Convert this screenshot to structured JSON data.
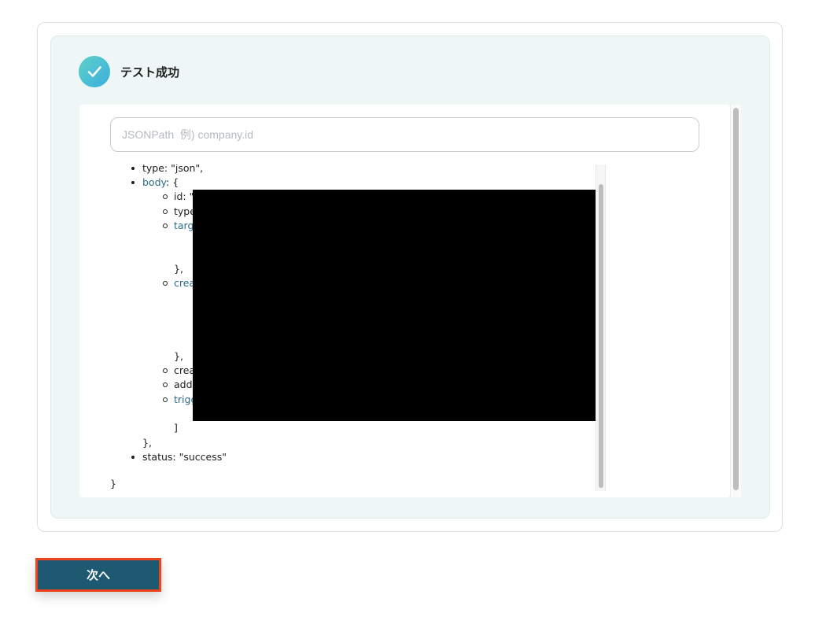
{
  "status": {
    "text": "テスト成功"
  },
  "search": {
    "placeholder": "JSONPath  例) company.id",
    "value": ""
  },
  "tree": {
    "lines": [
      {
        "prefix": "type: \"json\","
      },
      {
        "key": "body",
        "suffix": ": {"
      },
      {
        "text": "id: \""
      },
      {
        "text": "type"
      },
      {
        "key": "targ"
      },
      {
        "text": "},"
      },
      {
        "key": "crea"
      },
      {
        "text": "},"
      },
      {
        "text": "crea"
      },
      {
        "text": "addr"
      },
      {
        "key": "trigg"
      },
      {
        "text": "]"
      },
      {
        "text": "},"
      },
      {
        "prefix": "status: \"success\""
      },
      {
        "text": "}"
      }
    ]
  },
  "button": {
    "label": "次へ"
  },
  "colors": {
    "button_bg": "#1d5a72",
    "highlight_border": "#f0401c",
    "panel_bg": "#eef6f6",
    "link_key": "#2c6a8a",
    "check_gradient": [
      "#5fd1c8",
      "#3aaee0"
    ]
  }
}
